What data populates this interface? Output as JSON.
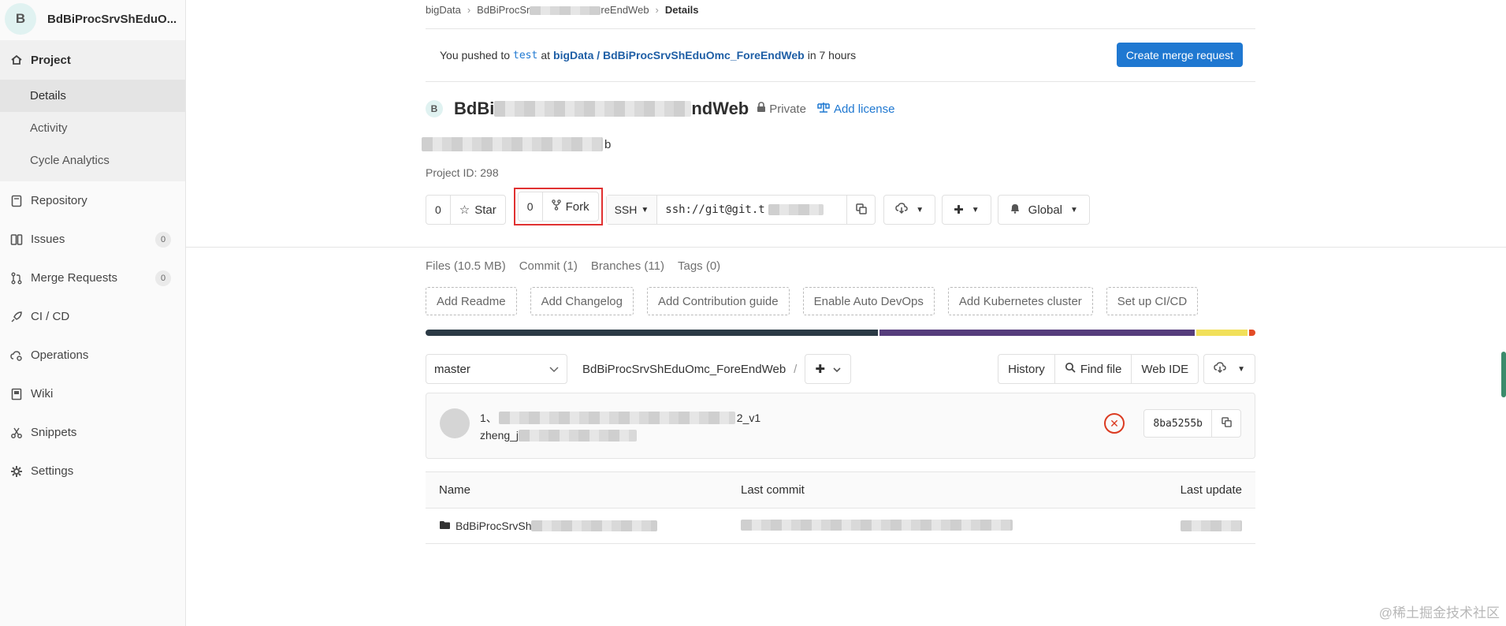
{
  "sidebar": {
    "avatar_letter": "B",
    "title": "BdBiProcSrvShEduO...",
    "project_label": "Project",
    "sub_items": [
      "Details",
      "Activity",
      "Cycle Analytics"
    ],
    "items": [
      {
        "label": "Repository",
        "icon": "repository-icon"
      },
      {
        "label": "Issues",
        "icon": "issues-icon",
        "badge": "0"
      },
      {
        "label": "Merge Requests",
        "icon": "merge-request-icon",
        "badge": "0"
      },
      {
        "label": "CI / CD",
        "icon": "rocket-icon"
      },
      {
        "label": "Operations",
        "icon": "cloud-gear-icon"
      },
      {
        "label": "Wiki",
        "icon": "book-icon"
      },
      {
        "label": "Snippets",
        "icon": "scissors-icon"
      },
      {
        "label": "Settings",
        "icon": "gear-icon"
      }
    ]
  },
  "breadcrumb": {
    "group": "bigData",
    "project_start": "BdBiProcSr",
    "project_end": "reEndWeb",
    "current": "Details"
  },
  "push_alert": {
    "prefix": "You pushed to",
    "branch": "test",
    "at": "at",
    "project_path": "bigData / BdBiProcSrvShEduOmc_ForeEndWeb",
    "suffix": "in 7 hours",
    "button": "Create merge request"
  },
  "project": {
    "avatar_letter": "B",
    "name_start": "BdBi",
    "name_end": "ndWeb",
    "visibility": "Private",
    "license_link": "Add license",
    "desc_end": "b",
    "id_label": "Project ID: 298"
  },
  "actions": {
    "star_count": "0",
    "star_label": "Star",
    "fork_count": "0",
    "fork_label": "Fork",
    "protocol": "SSH",
    "clone_url": "ssh://git@git.t",
    "notification": "Global"
  },
  "stats": [
    "Files (10.5 MB)",
    "Commit (1)",
    "Branches (11)",
    "Tags (0)"
  ],
  "setup_buttons": [
    "Add Readme",
    "Add Changelog",
    "Add Contribution guide",
    "Enable Auto DevOps",
    "Add Kubernetes cluster",
    "Set up CI/CD"
  ],
  "language_bar": [
    {
      "share": 0.548,
      "color": "#2b3a45"
    },
    {
      "share": 0.382,
      "color": "#563d7c"
    },
    {
      "share": 0.062,
      "color": "#f1e05a"
    },
    {
      "share": 0.008,
      "color": "#e34c26"
    }
  ],
  "tree_controls": {
    "branch": "master",
    "path": "BdBiProcSrvShEduOmc_ForeEndWeb",
    "slash": "/",
    "history": "History",
    "find_file": "Find file",
    "web_ide": "Web IDE"
  },
  "last_commit": {
    "title_start": "1、",
    "title_end": "2_v1",
    "author_start": "zheng_j",
    "sha": "8ba5255b"
  },
  "file_table": {
    "headers": [
      "Name",
      "Last commit",
      "Last update"
    ],
    "rows": [
      {
        "name_start": "BdBiProcSrvSh"
      }
    ]
  },
  "watermark": "@稀土掘金技术社区"
}
